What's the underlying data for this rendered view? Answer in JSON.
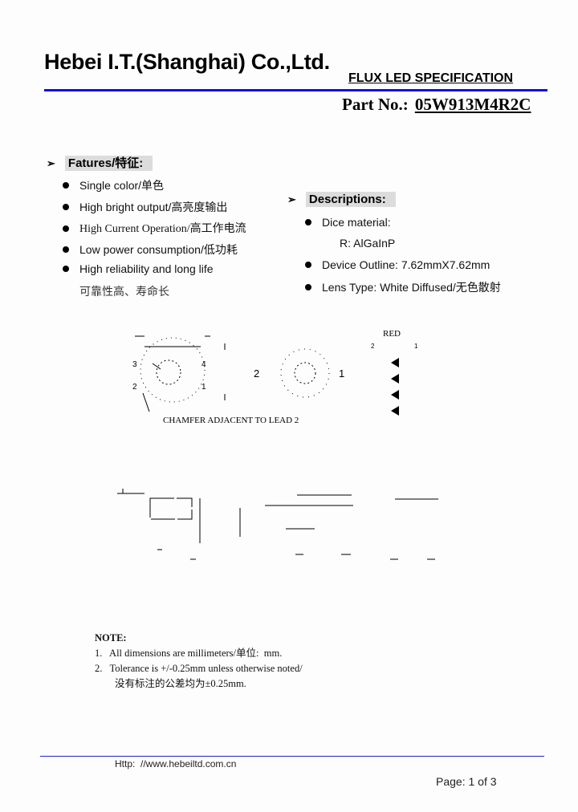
{
  "header": {
    "company": "Hebei I.T.(Shanghai) Co.,Ltd.",
    "spec_title": "FLUX LED SPECIFICATION",
    "part_label": "Part No.:",
    "part_number": "05W913M4R2C",
    "rule_color": "#1010e0"
  },
  "features": {
    "heading": "Fatures/特征:",
    "items": [
      "Single color/单色",
      "High bright output/高亮度输出",
      "High Current Operation/高工作电流",
      "Low power consumption/低功耗",
      "High reliability and long life"
    ],
    "continuation": "可靠性高、寿命长"
  },
  "descriptions": {
    "heading": "Descriptions:",
    "items": [
      {
        "label": "Dice material:",
        "sub": "R:  AlGaInP"
      },
      {
        "label": "Device Outline:  7.62mmX7.62mm"
      },
      {
        "label": "Lens Type:  White Diffused/无色散射"
      }
    ]
  },
  "diagram": {
    "lead_labels": [
      "3",
      "4",
      "2",
      "1"
    ],
    "side_labels": [
      "2",
      "1"
    ],
    "chamfer_note": "CHAMFER ADJACENT TO LEAD 2",
    "circuit_color": "RED",
    "circuit_pins": [
      "2",
      "1"
    ],
    "led_count": 4
  },
  "note": {
    "heading": "NOTE:",
    "items": [
      "1.   All dimensions are millimeters/单位:  mm.",
      "2.   Tolerance is +/-0.25mm unless otherwise noted/"
    ],
    "continuation": "没有标注的公差均为±0.25mm."
  },
  "footer": {
    "url": "Http:  //www.hebeiltd.com.cn",
    "page": "Page: 1 of 3"
  }
}
